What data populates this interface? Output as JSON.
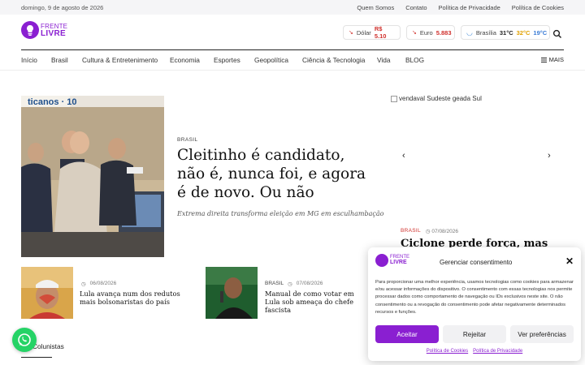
{
  "topbar": {
    "date": "domingo, 9 de agosto de 2026",
    "links": [
      "Quem Somos",
      "Contato",
      "Política de Privacidade",
      "Política de Cookies"
    ]
  },
  "logo": {
    "line1": "FRENTE",
    "line2": "LIVRE",
    "color": "#8a1fd1"
  },
  "tickers": {
    "dolar": {
      "label": "Dólar",
      "value": "R$ 5.10"
    },
    "euro": {
      "label": "Euro",
      "value": "5.883"
    },
    "weather": {
      "city": "Brasília",
      "now": "31°C",
      "max": "32°C",
      "min": "19°C"
    }
  },
  "nav": {
    "items": [
      "Início",
      "Brasil",
      "Cultura & Entretenimento",
      "Economia",
      "Esportes",
      "Geopolítica",
      "Ciência & Tecnologia",
      "Vida",
      "BLOG"
    ],
    "more": "MAIS"
  },
  "hero": {
    "category": "BRASIL",
    "title": "Cleitinho é candidato, não é, nunca foi, e agora é de novo. Ou não",
    "subtitle": "Extrema direita transforma eleição em MG em esculhambação",
    "image_text": "ticanos · 10"
  },
  "slider": {
    "image_alt": "vendaval Sudeste geada Sul",
    "category": "BRASIL",
    "date": "07/08/2026",
    "title": "Ciclone perde força, mas"
  },
  "secondary": [
    {
      "date": "06/08/2026",
      "title": "Lula avança num dos redutos mais bolsonaristas do país"
    },
    {
      "category": "BRASIL",
      "date": "07/08/2026",
      "title": "Manual de como votar em Lula sob ameaça do chefe fascista"
    }
  ],
  "section": {
    "colunistas": "Colunistas"
  },
  "consent": {
    "title": "Gerenciar consentimento",
    "text": "Para proporcionar uma melhor experiência, usamos tecnologias como cookies para armazenar e/ou acessar informações do dispositivo. O consentimento com essas tecnologias nos permite processar dados como comportamento de navegação ou IDs exclusivos neste site. O não consentimento ou a revogação do consentimento pode afetar negativamente determinados recursos e funções.",
    "accept": "Aceitar",
    "reject": "Rejeitar",
    "prefs": "Ver preferências",
    "link_cookies": "Política de Cookies",
    "link_privacy": "Política de Privacidade"
  },
  "colors": {
    "accent": "#8a1fd1",
    "down": "#d0312d",
    "whatsapp": "#25d366"
  }
}
